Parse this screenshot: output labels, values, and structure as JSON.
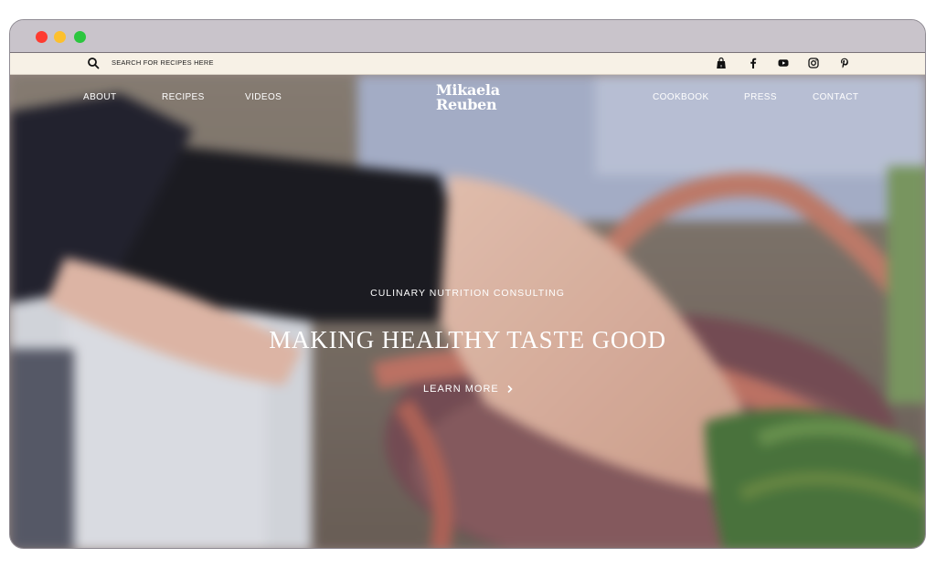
{
  "search": {
    "label": "SEARCH FOR RECIPES HERE"
  },
  "social_icons": [
    "shopping-bag-icon",
    "facebook-icon",
    "youtube-icon",
    "instagram-icon",
    "pinterest-icon"
  ],
  "nav": {
    "left": [
      {
        "label": "ABOUT"
      },
      {
        "label": "RECIPES"
      },
      {
        "label": "VIDEOS"
      }
    ],
    "right": [
      {
        "label": "COOKBOOK"
      },
      {
        "label": "PRESS"
      },
      {
        "label": "CONTACT"
      }
    ]
  },
  "logo": {
    "line1": "Mikaela",
    "line2": "Reuben"
  },
  "hero": {
    "eyebrow": "CULINARY NUTRITION CONSULTING",
    "headline": "MAKING HEALTHY TASTE GOOD",
    "cta_label": "LEARN MORE"
  },
  "colors": {
    "topbar_bg": "#f7f1e6",
    "chrome_bg": "#c9c4cb",
    "traffic_red": "#fe3b30",
    "traffic_yellow": "#fdc02c",
    "traffic_green": "#2bc63e"
  }
}
